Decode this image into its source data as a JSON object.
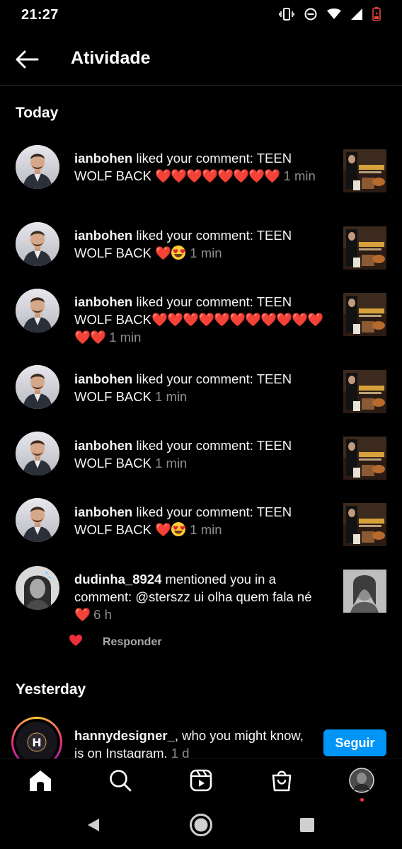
{
  "status_bar": {
    "time": "21:27"
  },
  "header": {
    "title": "Atividade"
  },
  "sections": {
    "today": "Today",
    "yesterday": "Yesterday"
  },
  "notifications": [
    {
      "username": "ianbohen",
      "action": " liked your comment: TEEN WOLF BACK ",
      "hearts": "❤️❤️❤️❤️❤️❤️❤️❤️",
      "emoji": "",
      "time": " 1 min"
    },
    {
      "username": "ianbohen",
      "action": " liked your comment: TEEN WOLF BACK ",
      "hearts": "❤️",
      "emoji": "heart-eyes",
      "time": " 1 min"
    },
    {
      "username": "ianbohen",
      "action": " liked your comment: TEEN WOLF BACK",
      "hearts": "❤️❤️❤️❤️❤️❤️❤️❤️❤️❤️❤️❤️❤️",
      "emoji": "",
      "time": " 1 min"
    },
    {
      "username": "ianbohen",
      "action": " liked your comment: TEEN WOLF BACK",
      "hearts": "",
      "emoji": "",
      "time": " 1 min"
    },
    {
      "username": "ianbohen",
      "action": " liked your comment: TEEN WOLF BACK",
      "hearts": "",
      "emoji": "",
      "time": " 1 min"
    },
    {
      "username": "ianbohen",
      "action": " liked your comment: TEEN WOLF BACK ",
      "hearts": "❤️",
      "emoji": "heart-eyes",
      "time": " 1 min"
    },
    {
      "username": "dudinha_8924",
      "action": " mentioned you in a comment: @sterszz ui olha quem fala né ",
      "hearts": "❤️",
      "emoji": "",
      "time": " 6 h"
    }
  ],
  "reply": {
    "label": "Responder"
  },
  "suggestion": {
    "username": "hannydesigner_",
    "action": ", who you might know, is on Instagram.",
    "time": " 1 d",
    "avatar_letter": "H",
    "follow_label": "Seguir"
  },
  "bottom_nav": [
    "home-icon",
    "search-icon",
    "reels-icon",
    "shop-icon",
    "profile-avatar"
  ],
  "colors": {
    "accent": "#0095f6",
    "heart": "#ed2f3a",
    "muted": "#8e8e8e",
    "notification_dot": "#ff3040"
  }
}
